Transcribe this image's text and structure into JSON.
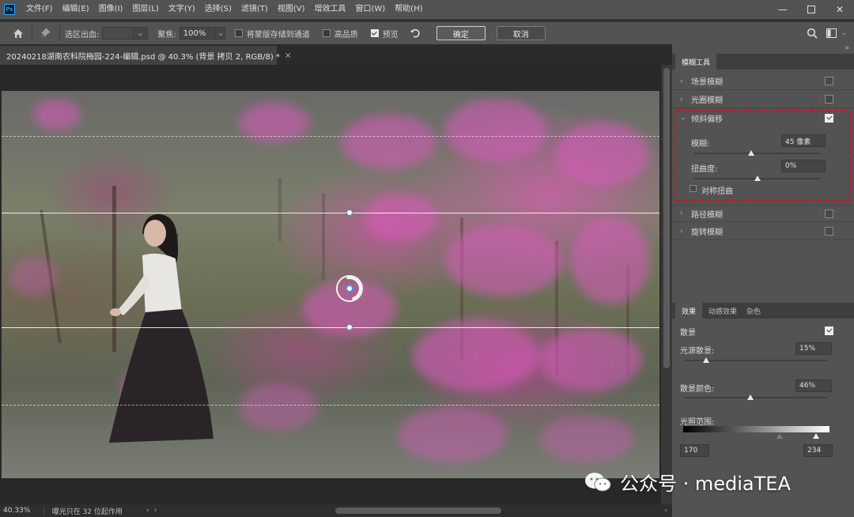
{
  "app": {
    "logo_text": "Ps"
  },
  "menu": [
    "文件(F)",
    "编辑(E)",
    "图像(I)",
    "图层(L)",
    "文字(Y)",
    "选择(S)",
    "滤镜(T)",
    "视图(V)",
    "增效工具",
    "窗口(W)",
    "帮助(H)"
  ],
  "options": {
    "selection_bleed_label": "选区出血:",
    "focus_label": "聚焦:",
    "focus_value": "100%",
    "save_mask_label": "将蒙版存储到通道",
    "high_quality_label": "高品质",
    "preview_label": "预览",
    "ok_label": "确定",
    "cancel_label": "取消"
  },
  "document": {
    "tab_title": "20240218湖南农科院梅园-224-编辑.psd @ 40.3% (背景 拷贝 2, RGB/8) *"
  },
  "status": {
    "zoom": "40.33%",
    "info": "曝光只在 32 位起作用"
  },
  "blur_gallery": {
    "tab": "模糊工具",
    "items": [
      {
        "label": "场景模糊",
        "checked": false
      },
      {
        "label": "光圈模糊",
        "checked": false
      },
      {
        "label": "倾斜偏移",
        "checked": true
      },
      {
        "label": "路径模糊",
        "checked": false
      },
      {
        "label": "旋转模糊",
        "checked": false
      }
    ],
    "tilt_shift": {
      "blur_label": "模糊:",
      "blur_value": "45 像素",
      "blur_fraction": 0.45,
      "distortion_label": "扭曲度:",
      "distortion_value": "0%",
      "distortion_fraction": 0.5,
      "symmetric_label": "对称扭曲"
    }
  },
  "effects": {
    "tabs": [
      "效果",
      "动感效果",
      "杂色"
    ],
    "bokeh_label": "散景",
    "light_bokeh_label": "光源散景:",
    "light_bokeh_value": "15%",
    "light_bokeh_fraction": 0.15,
    "bokeh_color_label": "散景颜色:",
    "bokeh_color_value": "46%",
    "bokeh_color_fraction": 0.46,
    "light_range_label": "光照范围:",
    "light_range_min": "170",
    "light_range_max": "234"
  },
  "watermark": {
    "text": "公众号 · mediaTEA"
  },
  "colors": {
    "accent_red": "#c8161d",
    "panel_bg": "#535353",
    "canvas_bg": "#282828"
  }
}
